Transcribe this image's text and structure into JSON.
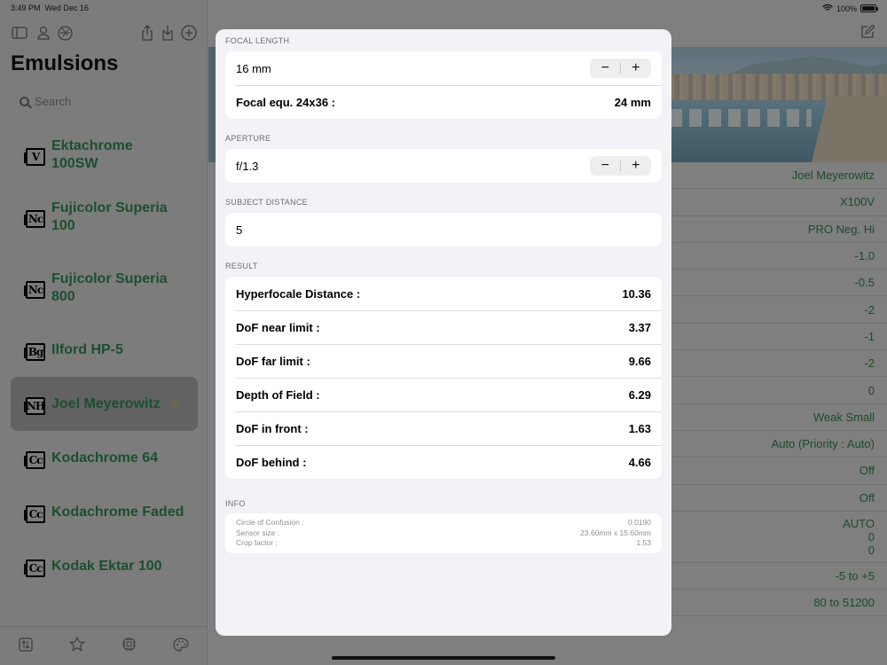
{
  "status_bar": {
    "time": "3:49 PM",
    "date": "Wed Dec 16",
    "battery": "100%"
  },
  "sidebar": {
    "title": "Emulsions",
    "search_placeholder": "Search",
    "items": [
      {
        "code": "V",
        "label": "Ektachrome 100SW"
      },
      {
        "code": "Nc",
        "label": "Fujicolor Superia 100"
      },
      {
        "code": "Nc",
        "label": "Fujicolor Superia 800"
      },
      {
        "code": "Bg",
        "label": "Ilford HP-5"
      },
      {
        "code": "NH",
        "label": "Joel Meyerowitz",
        "selected": true,
        "favorite": true
      },
      {
        "code": "Cc",
        "label": "Kodachrome 64"
      },
      {
        "code": "Cc",
        "label": "Kodachrome Faded"
      },
      {
        "code": "Cc",
        "label": "Kodak Ektar 100"
      }
    ],
    "toolbar_icons": [
      "sidebar-toggle-icon",
      "person-icon",
      "aperture-icon",
      "share-icon",
      "download-icon",
      "add-icon"
    ],
    "bottom_icons": [
      "sort-icon",
      "star-icon",
      "chip-icon",
      "palette-icon"
    ]
  },
  "detail": {
    "properties": [
      "Joel Meyerowitz",
      "X100V",
      "PRO Neg. Hi",
      "-1.0",
      "-0.5",
      "-2",
      "-1",
      "-2",
      "0",
      "Weak Small",
      "Auto (Priority : Auto)",
      "Off",
      "Off",
      [
        "AUTO",
        "0",
        "0"
      ],
      "-5 to +5",
      "80 to 51200"
    ]
  },
  "modal": {
    "focal_length": {
      "header": "FOCAL LENGTH",
      "value": "16 mm",
      "equiv_label": "Focal equ. 24x36 :",
      "equiv_value": "24 mm"
    },
    "aperture": {
      "header": "APERTURE",
      "value": "f/1.3"
    },
    "subject_distance": {
      "header": "SUBJECT DISTANCE",
      "value": "5"
    },
    "result": {
      "header": "RESULT",
      "rows": [
        {
          "label": "Hyperfocale Distance :",
          "value": "10.36"
        },
        {
          "label": "DoF near limit :",
          "value": "3.37"
        },
        {
          "label": "DoF far limit :",
          "value": "9.66"
        },
        {
          "label": "Depth of Field :",
          "value": "6.29"
        },
        {
          "label": "DoF in front :",
          "value": "1.63"
        },
        {
          "label": "DoF behind :",
          "value": "4.66"
        }
      ]
    },
    "info": {
      "header": "INFO",
      "rows": [
        {
          "label": "Circle of Confusion :",
          "value": "0.0190"
        },
        {
          "label": "Sensor size :",
          "value": "23.60mm x 15.60mm"
        },
        {
          "label": "Crop factor :",
          "value": "1.53"
        }
      ]
    },
    "stepper": {
      "minus": "−",
      "plus": "+"
    }
  }
}
